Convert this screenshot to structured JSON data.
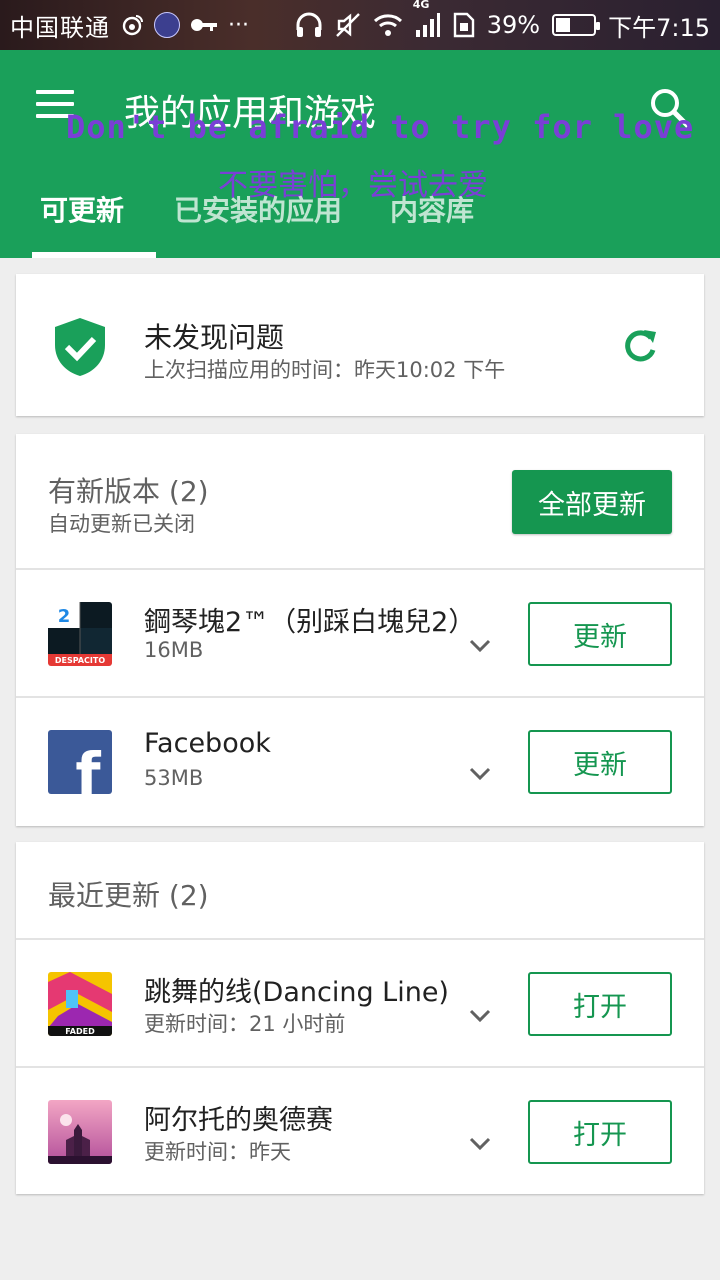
{
  "status_bar": {
    "carrier": "中国联通",
    "more": "···",
    "network": "4G",
    "battery_text": "39%",
    "battery_level": 0.39,
    "time": "下午7:15",
    "icons": [
      "weibo-icon",
      "avatar-icon",
      "key-icon",
      "headphones-icon",
      "mute-icon",
      "wifi-icon",
      "signal-icon",
      "sim-icon",
      "battery-icon"
    ]
  },
  "header": {
    "title": "我的应用和游戏",
    "overlay_en": "Don't be afraid to try for love",
    "overlay_zh": "不要害怕，尝试去爱",
    "tabs": [
      {
        "label": "可更新",
        "active": true
      },
      {
        "label": "已安装的应用",
        "active": false
      },
      {
        "label": "内容库",
        "active": false
      }
    ]
  },
  "scan": {
    "title": "未发现问题",
    "subtitle": "上次扫描应用的时间：昨天10:02 下午"
  },
  "updates": {
    "title": "有新版本 (2)",
    "subtitle": "自动更新已关闭",
    "update_all_label": "全部更新",
    "apps": [
      {
        "name": "鋼琴塊2™（别踩白塊兒2）",
        "meta": "16MB",
        "action": "更新",
        "icon_badge": "2",
        "icon_caption": "DESPACITO"
      },
      {
        "name": "Facebook",
        "meta": "53MB",
        "action": "更新",
        "icon_badge": "f"
      }
    ]
  },
  "recent": {
    "title": "最近更新 (2)",
    "apps": [
      {
        "name": "跳舞的线(Dancing Line)",
        "meta": "更新时间：21 小时前",
        "action": "打开",
        "icon_caption": "FADED"
      },
      {
        "name": "阿尔托的奥德赛",
        "meta": "更新时间：昨天",
        "action": "打开"
      }
    ]
  },
  "colors": {
    "primary": "#1aa05a",
    "button_green": "#159650",
    "overlay_purple": "#7a3fd6"
  }
}
